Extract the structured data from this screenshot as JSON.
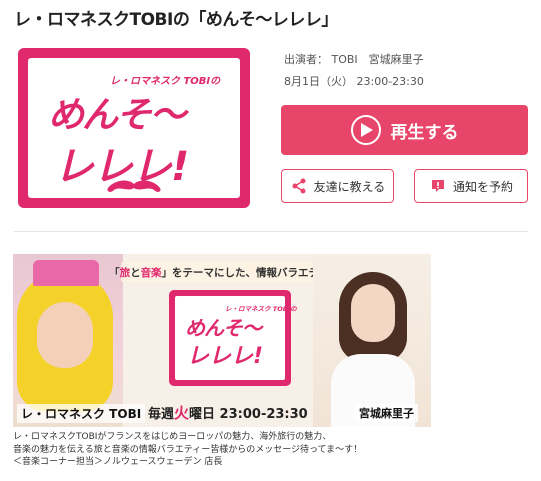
{
  "program": {
    "title": "レ・ロマネスクTOBIの「めんそ～レレレ」",
    "cast": "出演者：  TOBI　宮城麻里子",
    "airtime": "8月1日（火） 23:00-23:30"
  },
  "logo": {
    "small": "レ・ロマネスク TOBIの",
    "line1": "めんそ～",
    "line2": "レレレ!"
  },
  "actions": {
    "play_label": "再生する",
    "share_label": "友達に教える",
    "remind_label": "通知を予約"
  },
  "banner": {
    "theme_prefix": "「",
    "theme_word1": "旅",
    "theme_and": "と",
    "theme_word2": "音楽",
    "theme_suffix": "」をテーマにした、情報バラエティ",
    "logo_small": "レ・ロマネスク TOBIの",
    "logo_line1": "めんそ～",
    "logo_line2": "レレレ!",
    "schedule_prefix": "毎週",
    "schedule_day": "火",
    "schedule_suffix": "曜日 23:00-23:30",
    "name_left": "レ・ロマネスク TOBI",
    "name_right": "宮城麻里子"
  },
  "description": {
    "line1": "レ・ロマネスクTOBIがフランスをはじめヨーロッパの魅力、海外旅行の魅力、",
    "line2": "音楽の魅力を伝える旅と音楽の情報バラエティー皆様からのメッセージ待ってま～す！",
    "line3": "＜音楽コーナー担当＞ノルウェースウェーデン 店長"
  },
  "colors": {
    "accent": "#e8456a",
    "brand_pink": "#e0286d"
  },
  "icons": {
    "play": "play-icon",
    "share": "share-icon",
    "remind": "alert-icon"
  }
}
